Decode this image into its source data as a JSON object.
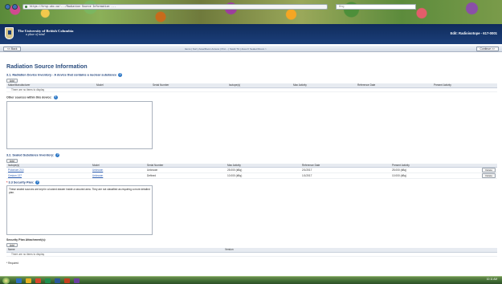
{
  "browser": {
    "url": "https://hrsp.ubc.ca/.../Radiation Source Information ...",
    "search_placeholder": "Bing"
  },
  "header": {
    "university": "The University of British Columbia",
    "motto": "a place of mind",
    "edit_title": "Edit: Radioisotope - 617-0001"
  },
  "navbar": {
    "back_label": "<< Back",
    "continue_label": "Continue >>",
    "breadcrumbs": "Items | Sort | Area/Room Access | Prot... | Swab Tlc | Area 0: Sealed Room >"
  },
  "page": {
    "title": "Radiation Source Information",
    "device_section": {
      "title": "3.1. Radiation Device Inventory - A device that contains a nuclear substance",
      "add_label": "Add",
      "headers": [
        "Make/Manufacturer",
        "Model",
        "Serial Number",
        "Isotope(s)",
        "Max Activity",
        "Reference Date",
        "Present Activity"
      ],
      "empty_text": "There are no items to display"
    },
    "other_sources": {
      "label": "Other sources within this device:",
      "value": ""
    },
    "sealed_section": {
      "title": "3.2. Sealed Substance Inventory:",
      "add_label": "Add",
      "headers": [
        "Isotope(s)",
        "Model",
        "Serial Number",
        "Max Activity",
        "Reference Date",
        "Present Activity",
        ""
      ],
      "rows": [
        {
          "isotope": "Polonium 210",
          "model": "Unknown",
          "serial": "Unknown",
          "max_activity": "25.000 (kBq)",
          "ref_date": "2/1/2017",
          "present_activity": "25.000 (kBq)",
          "action": "Delete"
        },
        {
          "isotope": "Cesium 137",
          "model": "Unknown",
          "serial": "Defined",
          "max_activity": "10.000 (kBq)",
          "ref_date": "1/1/2017",
          "present_activity": "10.000 (kBq)",
          "action": "Delete"
        }
      ]
    },
    "security_plan": {
      "label": "3.3 Security Plan:",
      "required_mark": "*",
      "value": "These sealed sources are kept in a locked drawer inside a secured area. They are not classified as requiring a more detailed plan."
    },
    "attachments": {
      "label": "Security Plan Attachment(s):",
      "add_label": "Add",
      "headers": [
        "Name",
        "Version"
      ],
      "empty_text": "There are no items to display"
    },
    "footnote": "* Required"
  },
  "taskbar": {
    "time": "10:11 AM"
  }
}
